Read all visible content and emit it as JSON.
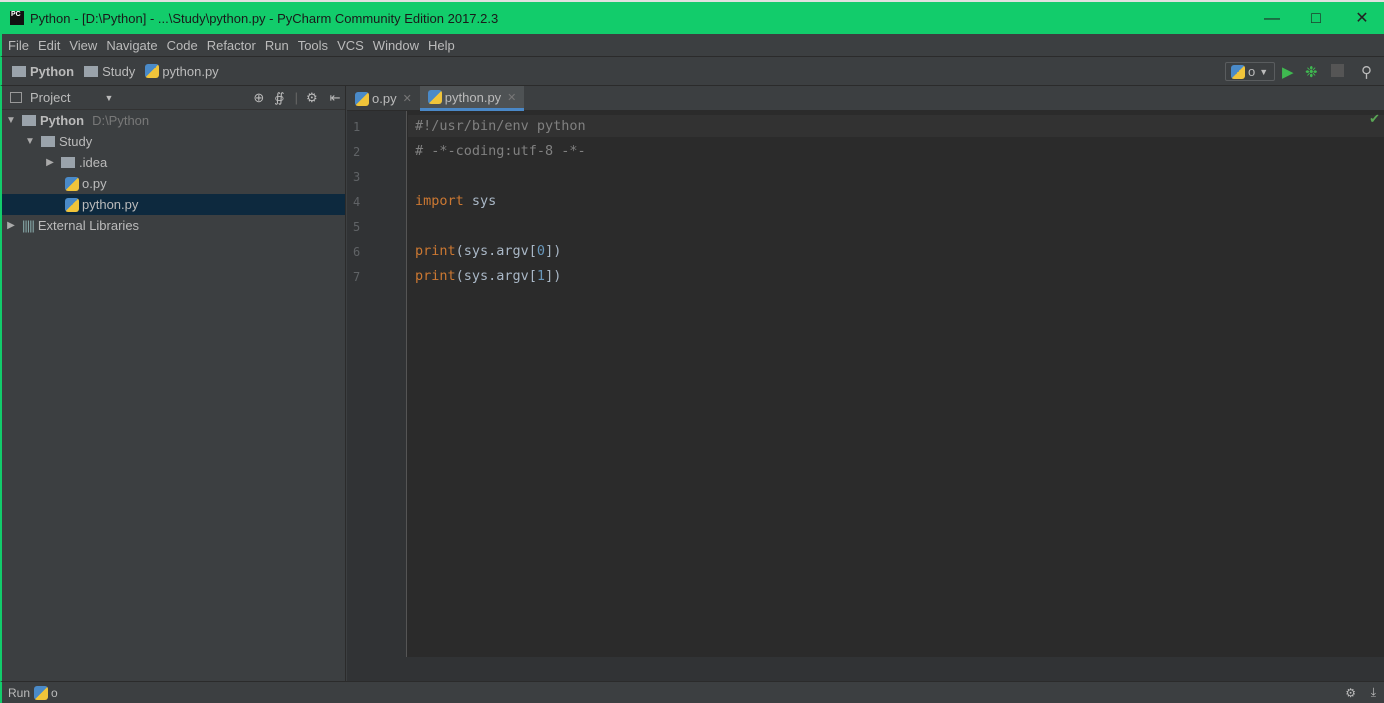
{
  "window": {
    "title": "Python - [D:\\Python] - ...\\Study\\python.py - PyCharm Community Edition 2017.2.3",
    "logo": "PC"
  },
  "menu": [
    "File",
    "Edit",
    "View",
    "Navigate",
    "Code",
    "Refactor",
    "Run",
    "Tools",
    "VCS",
    "Window",
    "Help"
  ],
  "breadcrumb": [
    "Python",
    "Study",
    "python.py"
  ],
  "run_config": "o",
  "project": {
    "header": "Project",
    "tree": [
      {
        "label": "Python",
        "hint": "D:\\Python"
      },
      {
        "label": "Study"
      },
      {
        "label": ".idea"
      },
      {
        "label": "o.py"
      },
      {
        "label": "python.py"
      },
      {
        "label": "External Libraries"
      }
    ]
  },
  "tabs": [
    {
      "label": "o.py"
    },
    {
      "label": "python.py"
    }
  ],
  "code": {
    "line_numbers": [
      "1",
      "2",
      "3",
      "4",
      "5",
      "6",
      "7"
    ],
    "l1": "#!/usr/bin/env python",
    "l2": "# -*-coding:utf-8 -*-",
    "l4_kw": "import",
    "l4_rest": " sys",
    "print": "print",
    "argv_open": "(sys.argv[",
    "zero": "0",
    "one": "1",
    "close": "])"
  },
  "status": {
    "run_label": "Run",
    "run_config": "o"
  }
}
